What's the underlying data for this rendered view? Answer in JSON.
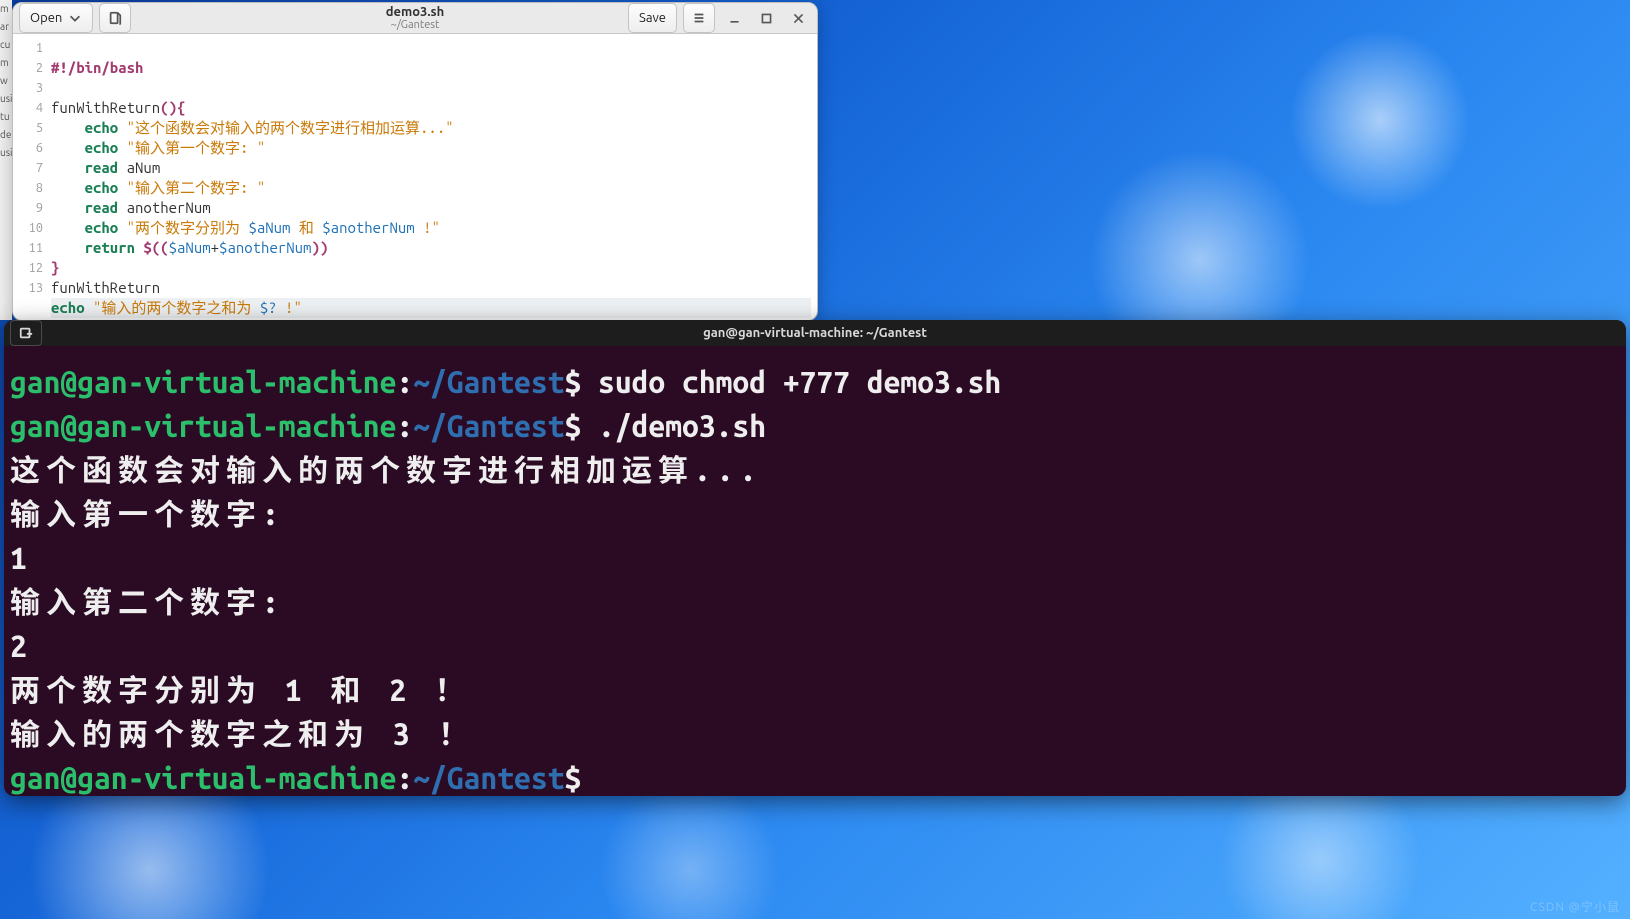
{
  "gedit": {
    "open_label": "Open",
    "save_label": "Save",
    "title": "demo3.sh",
    "subtitle": "~/Gantest",
    "code": {
      "l1_shebang": "#!/bin/bash",
      "l3_fn_name": "funWithReturn",
      "l3_braces": "(){",
      "l4_echo": "echo",
      "l4_str": "\"这个函数会对输入的两个数字进行相加运算...\"",
      "l5_echo": "echo",
      "l5_str": "\"输入第一个数字: \"",
      "l6_read": "read",
      "l6_var": " aNum",
      "l7_echo": "echo",
      "l7_str": "\"输入第二个数字: \"",
      "l8_read": "read",
      "l8_var": " anotherNum",
      "l9_echo": "echo",
      "l9_str_a": "\"两个数字分别为 ",
      "l9_var1": "$aNum",
      "l9_mid": " 和 ",
      "l9_var2": "$anotherNum",
      "l9_str_b": " !\"",
      "l10_return": "return",
      "l10_open": " $((",
      "l10_v1": "$aNum",
      "l10_plus": "+",
      "l10_v2": "$anotherNum",
      "l10_close": "))",
      "l11_brace": "}",
      "l12_call": "funWithReturn",
      "l13_echo": "echo",
      "l13_str_a": "\"输入的两个数字之和为 ",
      "l13_var": "$?",
      "l13_str_b": " !\""
    },
    "gutter": [
      "1",
      "2",
      "3",
      "4",
      "5",
      "6",
      "7",
      "8",
      "9",
      "10",
      "11",
      "12",
      "13"
    ]
  },
  "terminal": {
    "title": "gan@gan-virtual-machine: ~/Gantest",
    "prompt_user": "gan@gan-virtual-machine",
    "prompt_path": "~/Gantest",
    "prompt_dollar": "$",
    "cmd1": " sudo chmod +777 demo3.sh",
    "cmd2": " ./demo3.sh",
    "out": [
      "这个函数会对输入的两个数字进行相加运算...",
      "输入第一个数字: ",
      "1",
      "输入第二个数字: ",
      "2",
      "两个数字分别为 1 和 2 ！",
      "输入的两个数字之和为 3 ！"
    ]
  },
  "watermark": "CSDN @宁小鼠"
}
